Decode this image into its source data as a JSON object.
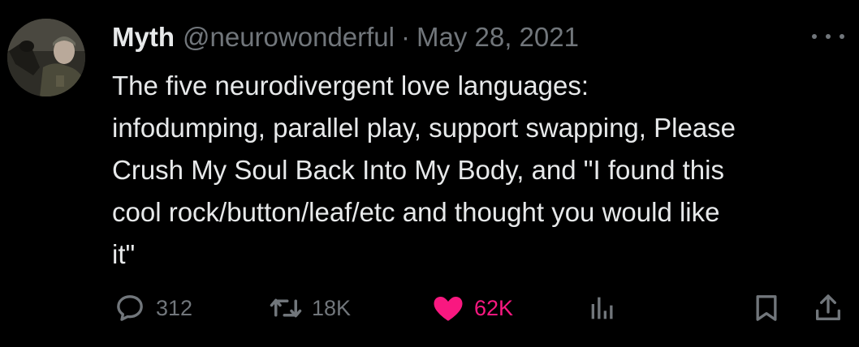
{
  "author": {
    "name": "Myth",
    "handle": "@neurowonderful",
    "separator": "·",
    "date": "May 28, 2021"
  },
  "text_lines": [
    "The five neurodivergent love languages:",
    "infodumping, parallel play, support swapping, Please",
    "Crush My Soul Back Into My Body, and \"I found this",
    "cool rock/button/leaf/etc and thought you would like",
    "it\""
  ],
  "actions": {
    "replies": "312",
    "reposts": "18K",
    "likes": "62K",
    "liked": true
  },
  "icons": [
    "more-icon",
    "reply-icon",
    "repost-icon",
    "like-icon",
    "views-icon",
    "bookmark-icon",
    "share-icon"
  ],
  "colors": {
    "background": "#000000",
    "text": "#e7e9ea",
    "secondary": "#71767b",
    "like": "#f91880"
  }
}
